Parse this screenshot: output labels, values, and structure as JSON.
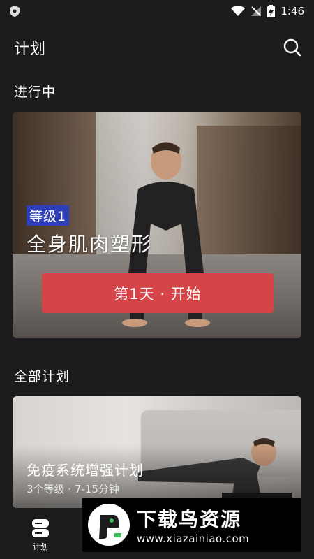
{
  "status_bar": {
    "time": "1:46",
    "icons": [
      "shield-icon",
      "wifi-icon",
      "no-signal-icon",
      "battery-charging-icon"
    ]
  },
  "header": {
    "title": "计划",
    "search_icon": "search-icon"
  },
  "in_progress": {
    "section_title": "进行中",
    "level": "等级1",
    "plan_name": "全身肌肉塑形",
    "start_button": "第1天 · 开始"
  },
  "all_plans": {
    "section_title": "全部计划",
    "items": [
      {
        "title": "免疫系统增强计划",
        "subtitle": "3个等级 · 7-15分钟"
      }
    ]
  },
  "bottom_nav": {
    "items": [
      {
        "label": "计划",
        "icon": "plan-icon"
      }
    ]
  },
  "watermark": {
    "title": "下载鸟资源",
    "url": "www.xiazainiao.com"
  },
  "colors": {
    "background": "#1c1c1e",
    "accent": "#d54447",
    "badge": "#2f3fb8"
  }
}
